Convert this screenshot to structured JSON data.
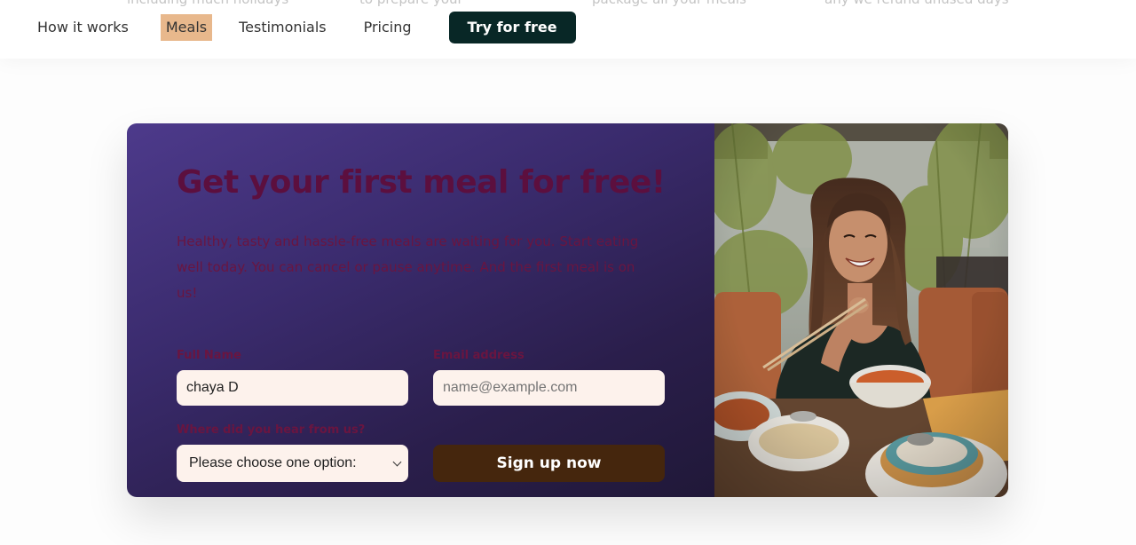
{
  "header": {
    "ghost_text": [
      "including much holidays",
      "to prepare your",
      "package all your meals",
      "any we refund unused days"
    ],
    "nav": [
      {
        "label": "How it works"
      },
      {
        "label": "Meals"
      },
      {
        "label": "Testimonials"
      },
      {
        "label": "Pricing"
      }
    ],
    "cta_label": "Try for free"
  },
  "cta": {
    "title": "Get your first meal for free!",
    "description": "Healthy, tasty and hassle-free meals are waiting for you. Start eating well today. You can cancel or pause anytime. And the first meal is on us!",
    "form": {
      "full_name": {
        "label": "Full Name",
        "value": "chaya D"
      },
      "email": {
        "label": "Email address",
        "placeholder": "name@example.com"
      },
      "source": {
        "label": "Where did you hear from us?",
        "selected": "Please choose one option:"
      },
      "submit_label": "Sign up now"
    }
  },
  "colors": {
    "nav_cta_bg": "#082726",
    "active_nav_highlight": "#e8b88c",
    "card_gradient_start": "#4d3a8b",
    "card_gradient_end": "#201838",
    "title_color": "#5c0f3e",
    "input_bg": "#fdf2ec",
    "signup_bg": "#45260d"
  }
}
